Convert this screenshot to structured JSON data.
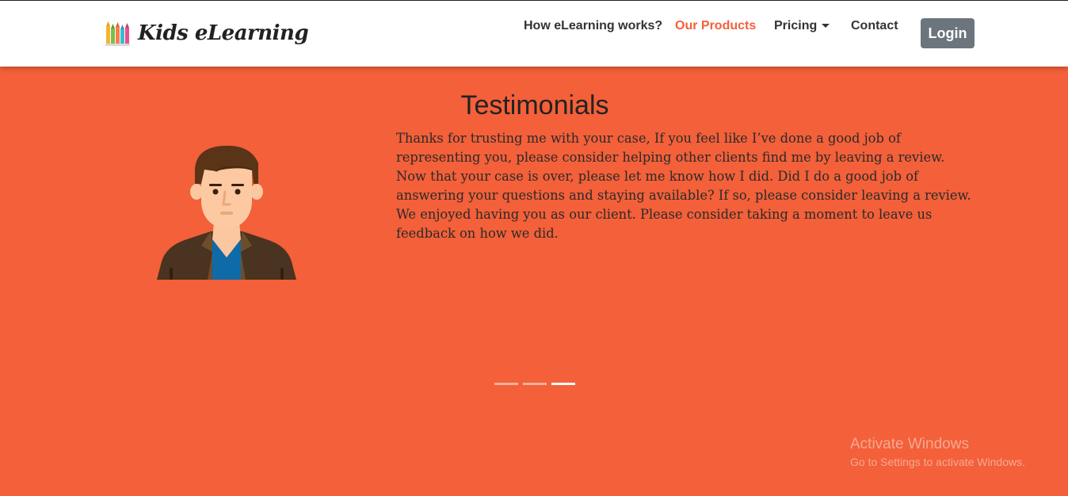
{
  "brand": {
    "name": "Kids eLearning",
    "logo_icon": "pencils-icon"
  },
  "nav": {
    "items": [
      {
        "label": "How eLearning works?"
      },
      {
        "label": "Our Products"
      },
      {
        "label": "Pricing"
      },
      {
        "label": "Contact"
      }
    ],
    "login_label": "Login"
  },
  "testimonials": {
    "title": "Testimonials",
    "avatar_icon": "man-avatar-icon",
    "quote": "Thanks for trusting me with your case, If you feel like I’ve done a good job of representing you, please consider helping other clients find me by leaving a review. Now that your case is over, please let me know how I did. Did I do a good job of answering your questions and staying available? If so, please consider leaving a review. We enjoyed having you as our client. Please consider taking a moment to leave us feedback on how we did.",
    "slide_count": 3,
    "active_slide": 3
  },
  "watermark": {
    "title": "Activate Windows",
    "subtitle": "Go to Settings to activate Windows."
  },
  "colors": {
    "accent": "#f36039",
    "navbar_bg": "#ffffff",
    "login_bg": "#6c757d",
    "text": "#222222"
  }
}
